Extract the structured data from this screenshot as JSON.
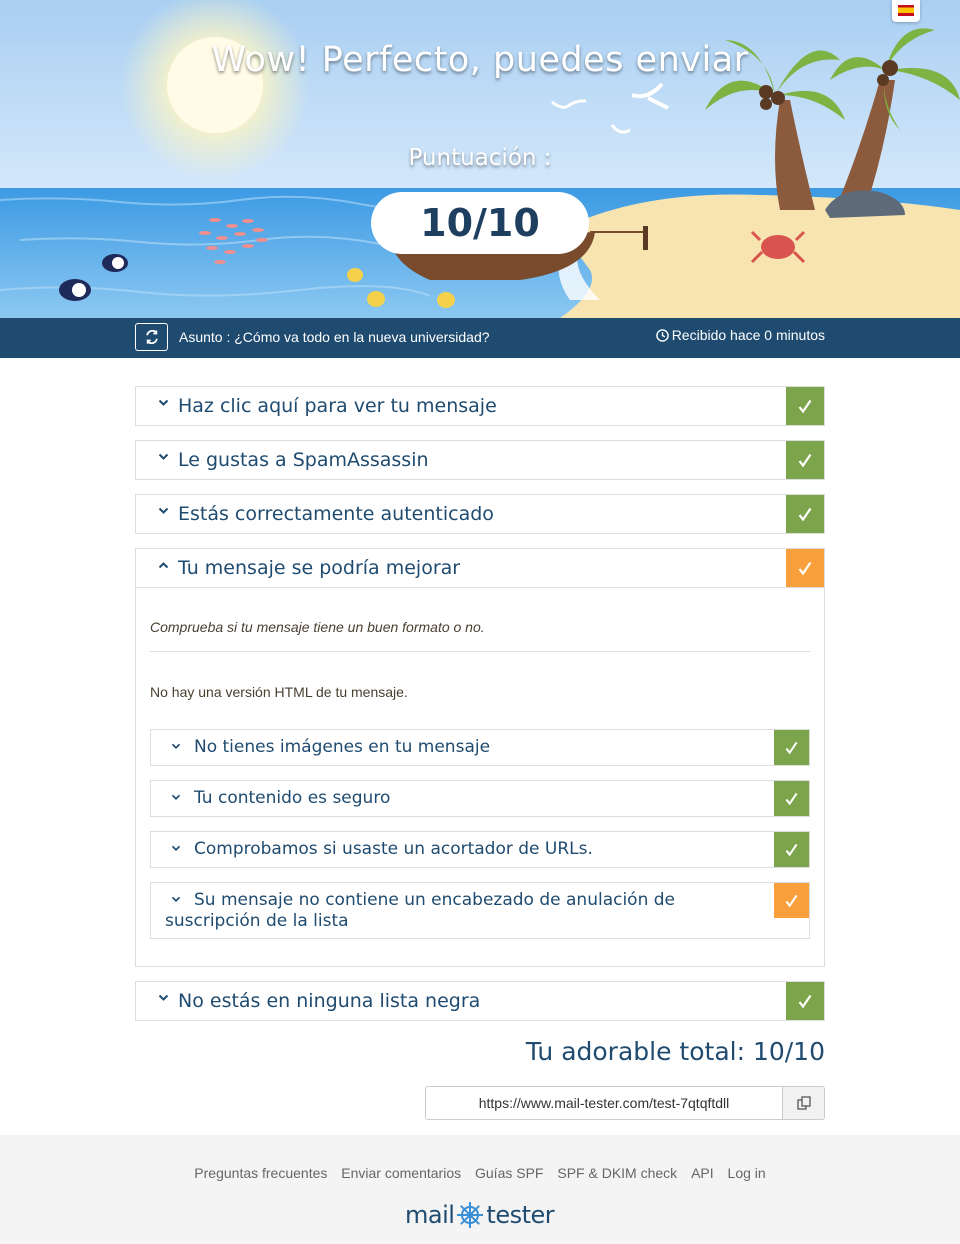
{
  "header": {
    "title": "Wow! Perfecto, puedes enviar",
    "score_label": "Puntuación :",
    "score": "10/10",
    "language_icon": "spain-flag-icon"
  },
  "subject_bar": {
    "subject": "Asunto : ¿Cómo va todo en la nueva universidad?",
    "received": "Recibido hace 0 minutos",
    "refresh_icon": "refresh-icon",
    "clock_icon": "clock-icon"
  },
  "panels": [
    {
      "title": "Haz clic aquí para ver tu mensaje",
      "status": "ok"
    },
    {
      "title": "Le gustas a SpamAssassin",
      "status": "ok"
    },
    {
      "title": "Estás correctamente autenticado",
      "status": "ok"
    },
    {
      "title": "Tu mensaje se podría mejorar",
      "status": "warn",
      "intro": "Comprueba si tu mensaje tiene un buen formato o no.",
      "note": "No hay una versión HTML de tu mensaje.",
      "checks": [
        {
          "title": "No tienes imágenes en tu mensaje",
          "status": "ok"
        },
        {
          "title": "Tu contenido es seguro",
          "status": "ok"
        },
        {
          "title": "Comprobamos si usaste un acortador de URLs.",
          "status": "ok"
        },
        {
          "title": "Su mensaje no contiene un encabezado de anulación de suscripción de la lista",
          "status": "warn"
        }
      ]
    },
    {
      "title": "No estás en ninguna lista negra",
      "status": "ok"
    }
  ],
  "total": "Tu adorable total: 10/10",
  "share": {
    "url": "https://www.mail-tester.com/test-7qtqftdll",
    "copy_icon": "copy-icon"
  },
  "footer": {
    "links": [
      "Preguntas frecuentes",
      "Enviar comentarios",
      "Guías SPF",
      "SPF & DKIM check",
      "API",
      "Log in"
    ],
    "logo_left": "mail",
    "logo_right": "tester"
  },
  "colors": {
    "ok": "#7ca54b",
    "warn": "#f9a03d",
    "brand": "#1f4b70"
  }
}
